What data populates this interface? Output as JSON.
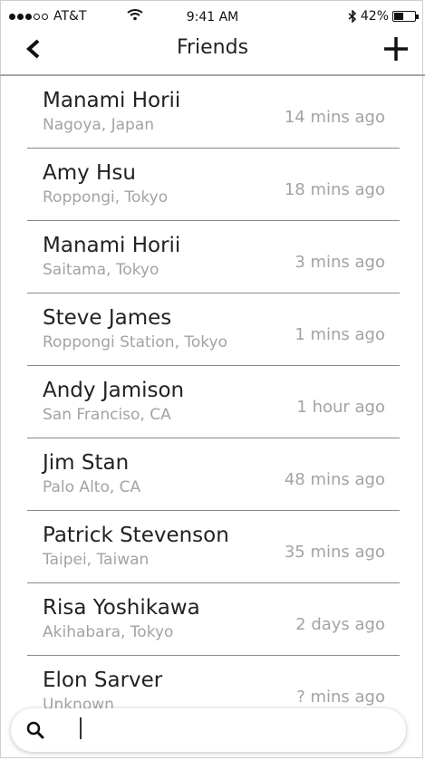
{
  "status_bar": {
    "carrier": "AT&T",
    "time": "9:41 AM",
    "battery": "42%",
    "battery_level": 0.42
  },
  "nav": {
    "title": "Friends"
  },
  "friends": [
    {
      "name": "Manami Horii",
      "location": "Nagoya, Japan",
      "time": "14 mins ago"
    },
    {
      "name": "Amy Hsu",
      "location": "Roppongi, Tokyo",
      "time": "18 mins ago"
    },
    {
      "name": "Manami Horii",
      "location": "Saitama, Tokyo",
      "time": "3 mins ago"
    },
    {
      "name": "Steve James",
      "location": "Roppongi Station, Tokyo",
      "time": "1 mins ago"
    },
    {
      "name": "Andy Jamison",
      "location": "San Franciso, CA",
      "time": "1 hour ago"
    },
    {
      "name": "Jim Stan",
      "location": "Palo Alto, CA",
      "time": "48 mins ago"
    },
    {
      "name": "Patrick Stevenson",
      "location": "Taipei, Taiwan",
      "time": "35 mins ago"
    },
    {
      "name": "Risa Yoshikawa",
      "location": "Akihabara, Tokyo",
      "time": "2 days ago"
    },
    {
      "name": "Elon Sarver",
      "location": "Unknown",
      "time": "? mins ago"
    }
  ],
  "search": {
    "value": "",
    "placeholder": ""
  }
}
